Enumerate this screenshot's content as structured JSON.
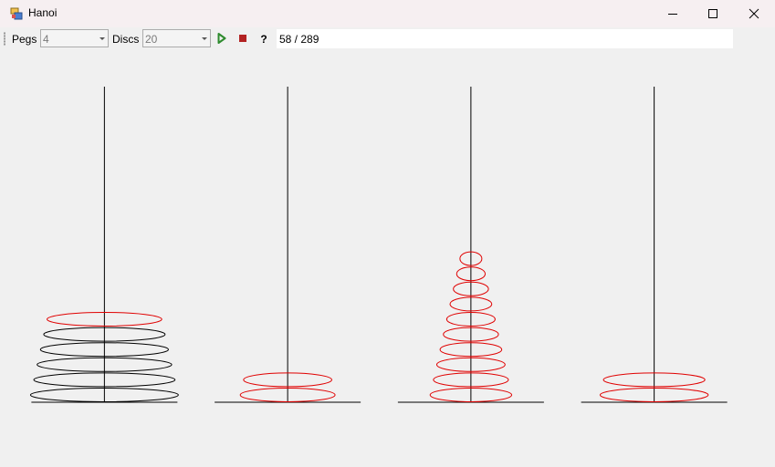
{
  "window": {
    "title": "Hanoi"
  },
  "toolbar": {
    "pegs_label": "Pegs",
    "pegs_value": "4",
    "discs_label": "Discs",
    "discs_value": "20",
    "progress_text": "58 / 289"
  },
  "icons": {
    "play": "play-icon",
    "stop": "stop-icon",
    "help": "help-icon"
  },
  "colors": {
    "active_disc": "#e00000",
    "disc": "#000000",
    "play": "#2e8b2e",
    "stop": "#b22222"
  },
  "pegs": [
    {
      "discs": [
        {
          "size": 20,
          "color": "black"
        },
        {
          "size": 19,
          "color": "black"
        },
        {
          "size": 18,
          "color": "black"
        },
        {
          "size": 17,
          "color": "black"
        },
        {
          "size": 16,
          "color": "black"
        },
        {
          "size": 15,
          "color": "red"
        }
      ]
    },
    {
      "discs": [
        {
          "size": 12,
          "color": "red"
        },
        {
          "size": 11,
          "color": "red"
        }
      ]
    },
    {
      "discs": [
        {
          "size": 10,
          "color": "red"
        },
        {
          "size": 9,
          "color": "red"
        },
        {
          "size": 8,
          "color": "red"
        },
        {
          "size": 7,
          "color": "red"
        },
        {
          "size": 6,
          "color": "red"
        },
        {
          "size": 5,
          "color": "red"
        },
        {
          "size": 4,
          "color": "red"
        },
        {
          "size": 3,
          "color": "red"
        },
        {
          "size": 2,
          "color": "red"
        },
        {
          "size": 1,
          "color": "red"
        }
      ]
    },
    {
      "discs": [
        {
          "size": 14,
          "color": "red"
        },
        {
          "size": 13,
          "color": "red"
        }
      ]
    }
  ]
}
